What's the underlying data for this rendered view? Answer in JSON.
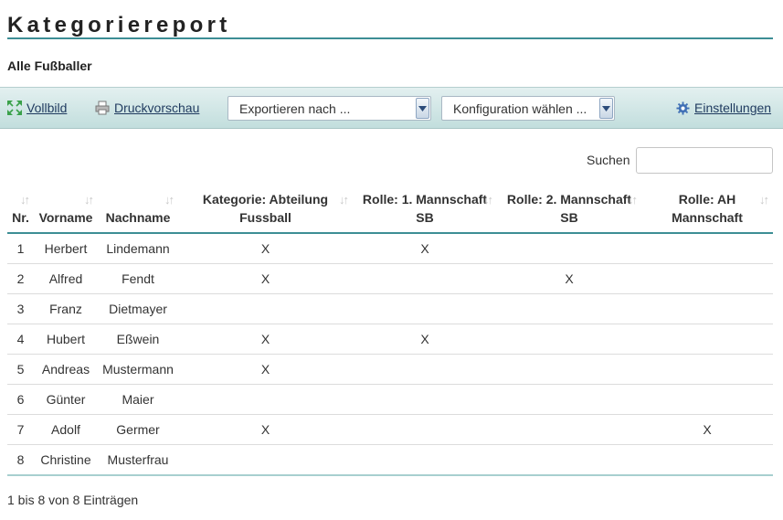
{
  "page": {
    "title": "Kategoriereport",
    "subtitle": "Alle Fußballer"
  },
  "toolbar": {
    "fullscreen_label": "Vollbild",
    "print_preview_label": "Druckvorschau",
    "export_select": "Exportieren nach ...",
    "config_select": "Konfiguration wählen ...",
    "settings_label": "Einstellungen"
  },
  "search": {
    "label": "Suchen",
    "value": ""
  },
  "table": {
    "columns": [
      "Nr.",
      "Vorname",
      "Nachname",
      "Kategorie: Abteilung Fussball",
      "Rolle: 1. Mannschaft SB",
      "Rolle: 2. Mannschaft SB",
      "Rolle: AH Mannschaft"
    ],
    "rows": [
      [
        "1",
        "Herbert",
        "Lindemann",
        "X",
        "X",
        "",
        ""
      ],
      [
        "2",
        "Alfred",
        "Fendt",
        "X",
        "",
        "X",
        ""
      ],
      [
        "3",
        "Franz",
        "Dietmayer",
        "",
        "",
        "",
        ""
      ],
      [
        "4",
        "Hubert",
        "Eßwein",
        "X",
        "X",
        "",
        ""
      ],
      [
        "5",
        "Andreas",
        "Mustermann",
        "X",
        "",
        "",
        ""
      ],
      [
        "6",
        "Günter",
        "Maier",
        "",
        "",
        "",
        ""
      ],
      [
        "7",
        "Adolf",
        "Germer",
        "X",
        "",
        "",
        "X"
      ],
      [
        "8",
        "Christine",
        "Musterfrau",
        "",
        "",
        "",
        ""
      ]
    ]
  },
  "info": "1 bis 8 von 8 Einträgen",
  "colors": {
    "accent": "#3d8e95",
    "toolbar_top": "#e3f0f0",
    "toolbar_bottom": "#c2dedd",
    "link": "#1f3a5f"
  },
  "icons": {
    "fullscreen": "expand-arrows-icon",
    "print": "printer-icon",
    "settings": "gear-icon",
    "dropdown": "chevron-down-icon",
    "sort": "sort-arrows-icon"
  }
}
